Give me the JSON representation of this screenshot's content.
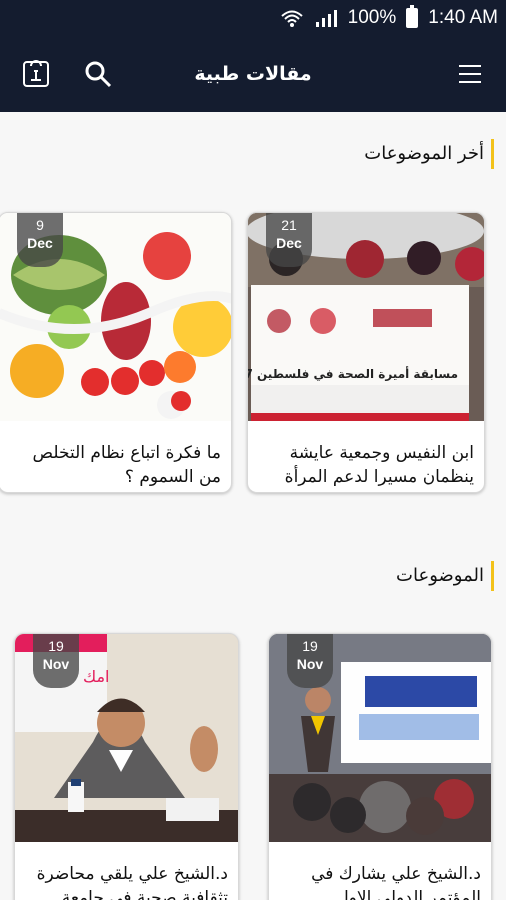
{
  "status": {
    "battery": "100%",
    "time": "1:40 AM"
  },
  "app_bar": {
    "title": "مقالات طبية"
  },
  "sections": [
    {
      "title": "أخر الموضوعات"
    },
    {
      "title": "الموضوعات"
    }
  ],
  "latest_cards": [
    {
      "day": "9",
      "month": "Dec",
      "caption": "ما فكرة اتباع نظام التخلص من السموم ؟"
    },
    {
      "day": "21",
      "month": "Dec",
      "caption": "ابن النفيس وجمعية عايشة ينظمان مسيرا لدعم المرأة"
    }
  ],
  "topic_cards": [
    {
      "day": "19",
      "month": "Nov",
      "caption": "د.الشيخ علي يلقي محاضرة تثقافية صحية في جامعة..."
    },
    {
      "day": "19",
      "month": "Nov",
      "caption": "د.الشيخ علي يشارك في المؤتمر الدولي الاول..."
    }
  ]
}
